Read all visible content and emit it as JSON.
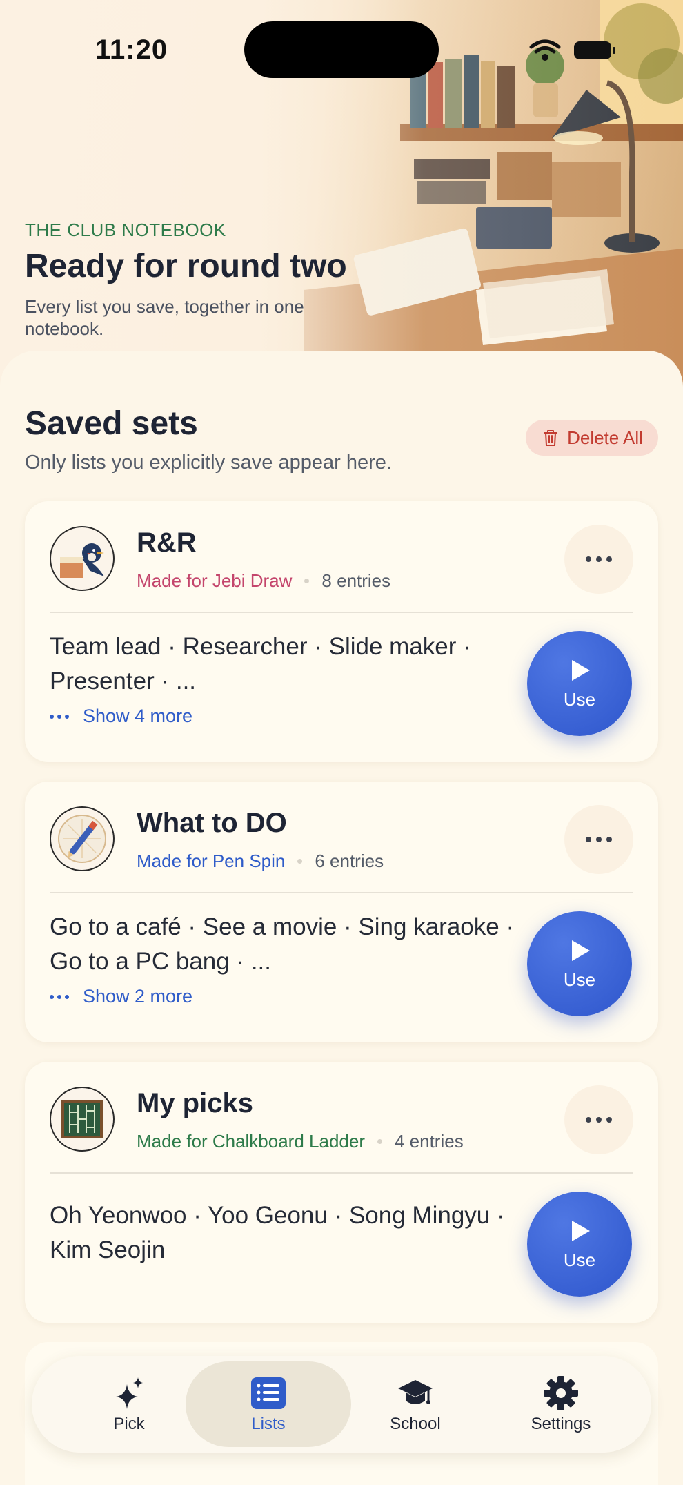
{
  "status_bar": {
    "time": "11:20"
  },
  "hero": {
    "eyebrow": "THE CLUB NOTEBOOK",
    "title": "Ready for round two",
    "subtitle": "Every list you save, together in one notebook."
  },
  "saved": {
    "title": "Saved sets",
    "subtitle": "Only lists you explicitly save appear here.",
    "delete_all_label": "Delete All"
  },
  "cards": [
    {
      "title": "R&R",
      "made_for": "Made for Jebi Draw",
      "made_for_color": "#c4456c",
      "entries": "8 entries",
      "items_text": "Team lead · Researcher · Slide maker · Presenter · ...",
      "show_more": "Show 4 more",
      "use_label": "Use",
      "avatar_icon": "swallow-icon"
    },
    {
      "title": "What to DO",
      "made_for": "Made for Pen Spin",
      "made_for_color": "#2f5cc9",
      "entries": "6 entries",
      "items_text": "Go to a café · See a movie · Sing karaoke · Go to a PC bang · ...",
      "show_more": "Show 2 more",
      "use_label": "Use",
      "avatar_icon": "pen-icon"
    },
    {
      "title": "My picks",
      "made_for": "Made for Chalkboard Ladder",
      "made_for_color": "#2e7b4a",
      "entries": "4 entries",
      "items_text": "Oh Yeonwoo · Yoo Geonu · Song Mingyu · Kim Seojin",
      "use_label": "Use",
      "avatar_icon": "chalkboard-icon"
    }
  ],
  "tabs": [
    {
      "label": "Pick",
      "icon": "sparkle-icon",
      "active": false
    },
    {
      "label": "Lists",
      "icon": "list-icon",
      "active": true
    },
    {
      "label": "School",
      "icon": "graduation-cap-icon",
      "active": false
    },
    {
      "label": "Settings",
      "icon": "gear-icon",
      "active": false
    }
  ],
  "colors": {
    "accent": "#2f5cc9",
    "danger": "#c23b30",
    "eyebrow": "#2e7b4a"
  }
}
